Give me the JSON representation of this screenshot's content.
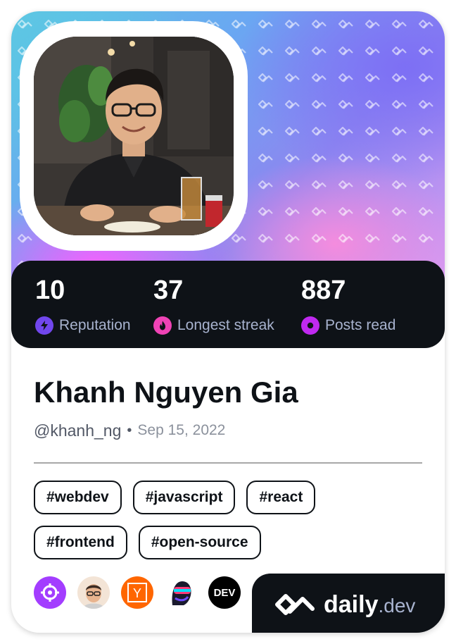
{
  "profile": {
    "name": "Khanh Nguyen Gia",
    "handle": "@khanh_ng",
    "separator": "•",
    "joined": "Sep 15, 2022"
  },
  "stats": [
    {
      "value": "10",
      "label": "Reputation",
      "icon": "lightning-icon",
      "color": "#7147ed"
    },
    {
      "value": "37",
      "label": "Longest streak",
      "icon": "flame-icon",
      "color": "#ef43b5"
    },
    {
      "value": "887",
      "label": "Posts read",
      "icon": "eye-icon",
      "color": "#c029f0"
    }
  ],
  "tags": [
    "#webdev",
    "#javascript",
    "#react",
    "#frontend",
    "#open-source"
  ],
  "sources": [
    {
      "name": "crosshair-source-icon",
      "color": "#a33dff"
    },
    {
      "name": "memoji-avatar-source-icon",
      "color": "#f3c8a8"
    },
    {
      "name": "y-combinator-source-icon",
      "color": "#ff6600",
      "letter": "Y"
    },
    {
      "name": "visor-head-source-icon",
      "color": "#4b3cff"
    },
    {
      "name": "dev-to-source-icon",
      "color": "#000000",
      "letter": "DEV"
    }
  ],
  "brand": {
    "name": "daily",
    "suffix": ".dev",
    "icon": "daily-dev-logo-icon"
  },
  "colors": {
    "card_dark": "#0e1217",
    "stat_label": "#a8b3cf",
    "text_primary": "#0e1217",
    "text_secondary": "#525866"
  }
}
